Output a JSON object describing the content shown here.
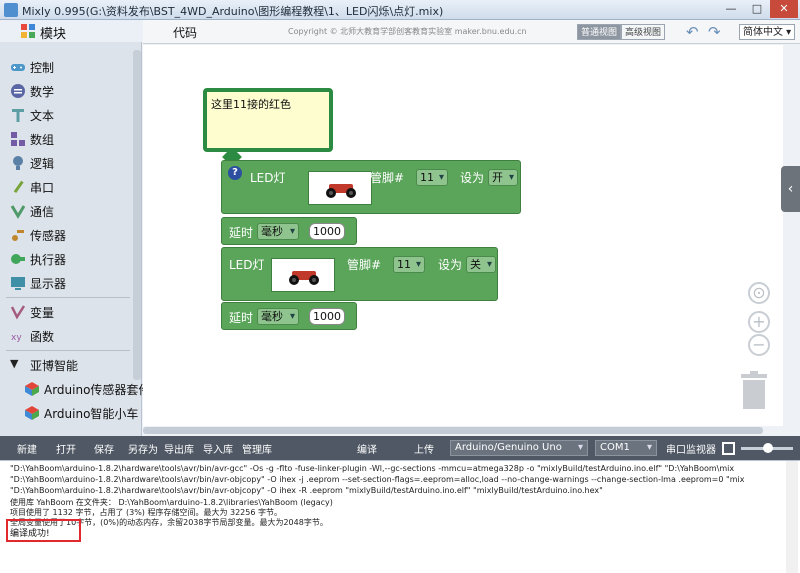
{
  "window": {
    "title": "Mixly 0.995(G:\\资料发布\\BST_4WD_Arduino\\图形编程教程\\1、LED闪烁\\点灯.mix)",
    "minimize": "—",
    "maximize": "□",
    "close": "✕"
  },
  "sidebar": {
    "header": "模块",
    "categories": [
      {
        "label": "控制",
        "icon": "gamepad-icon",
        "color": "#4c97c9"
      },
      {
        "label": "数学",
        "icon": "math-icon",
        "color": "#5b67a5"
      },
      {
        "label": "文本",
        "icon": "text-icon",
        "color": "#5b9fa5"
      },
      {
        "label": "数组",
        "icon": "array-icon",
        "color": "#745ba5"
      },
      {
        "label": "逻辑",
        "icon": "logic-icon",
        "color": "#5b80a5"
      },
      {
        "label": "串口",
        "icon": "serial-icon",
        "color": "#78a53a"
      },
      {
        "label": "通信",
        "icon": "communication-icon",
        "color": "#4f9a6a"
      },
      {
        "label": "传感器",
        "icon": "sensor-icon",
        "color": "#c0872d"
      },
      {
        "label": "执行器",
        "icon": "actuator-icon",
        "color": "#3fa65a"
      },
      {
        "label": "显示器",
        "icon": "display-icon",
        "color": "#3f8fa6"
      },
      {
        "label": "变量",
        "icon": "variable-icon",
        "color": "#a55b80"
      },
      {
        "label": "函数",
        "icon": "function-icon",
        "color": "#995ba5"
      }
    ],
    "group": "亚博智能",
    "group_items": [
      {
        "label": "Arduino传感器套件",
        "icon": "cube-icon"
      },
      {
        "label": "Arduino智能小车",
        "icon": "cube-icon"
      }
    ]
  },
  "tabbar": {
    "code_tab": "代码",
    "copyright": "Copyright © 北师大教育学部创客教育实验室 maker.bnu.edu.cn",
    "view_normal": "普通视图",
    "view_advanced": "高级视图",
    "undo": "↶",
    "redo": "↷",
    "language": "简体中文"
  },
  "workspace": {
    "comment": "这里11接的红色",
    "blocks": [
      {
        "label": "LED灯",
        "pin_label": "管脚#",
        "pin": "11",
        "set_label": "设为",
        "state": "开"
      },
      {
        "label": "延时",
        "unit": "毫秒",
        "value": "1000"
      },
      {
        "label": "LED灯",
        "pin_label": "管脚#",
        "pin": "11",
        "set_label": "设为",
        "state": "关"
      },
      {
        "label": "延时",
        "unit": "毫秒",
        "value": "1000"
      }
    ],
    "info_badge": "?",
    "zoom_in": "+",
    "zoom_out": "−",
    "flyout_toggle": "‹"
  },
  "toolbar": {
    "new": "新建",
    "open": "打开",
    "save": "保存",
    "save_as": "另存为",
    "export_lib": "导出库",
    "import_lib": "导入库",
    "manage_lib": "管理库",
    "compile": "编译",
    "upload": "上传",
    "board": "Arduino/Genuino Uno",
    "port": "COM1",
    "serial_monitor": "串口监视器"
  },
  "console": {
    "lines": [
      "\"D:\\YahBoom\\arduino-1.8.2\\hardware\\tools\\avr/bin/avr-gcc\"  -Os -g -flto -fuse-linker-plugin -Wl,--gc-sections -mmcu=atmega328p  -o \"mixlyBuild/testArduino.ino.elf\" \"D:\\YahBoom\\mix",
      "\"D:\\YahBoom\\arduino-1.8.2\\hardware\\tools\\avr/bin/avr-objcopy\" -O ihex -j .eeprom --set-section-flags=.eeprom=alloc,load --no-change-warnings --change-section-lma .eeprom=0  \"mix",
      "\"D:\\YahBoom\\arduino-1.8.2\\hardware\\tools\\avr/bin/avr-objcopy\" -O ihex -R .eeprom  \"mixlyBuild/testArduino.ino.elf\" \"mixlyBuild/testArduino.ino.hex\"",
      "使用库 YahBoom 在文件夹：  D:\\YahBoom\\arduino-1.8.2\\libraries\\YahBoom (legacy)",
      "项目使用了 1132 字节，占用了 (3%) 程序存储空间。最大为 32256 字节。",
      "全局变量使用了10字节，(0%)的动态内存，余留2038字节局部变量。最大为2048字节。"
    ],
    "success": "编译成功!"
  }
}
